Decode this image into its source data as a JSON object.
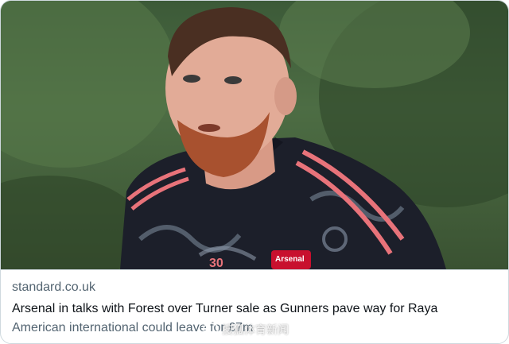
{
  "card": {
    "domain": "standard.co.uk",
    "title": "Arsenal in talks with Forest over Turner sale as Gunners pave way for Raya",
    "description": "American international could leave for £7m"
  },
  "image": {
    "badge_text": "Arsenal",
    "shirt_number": "30"
  },
  "watermark": {
    "text": "搜狐体育新闻"
  },
  "colors": {
    "border": "#cfd9de",
    "domain_text": "#536471",
    "title_text": "#0f1419"
  }
}
